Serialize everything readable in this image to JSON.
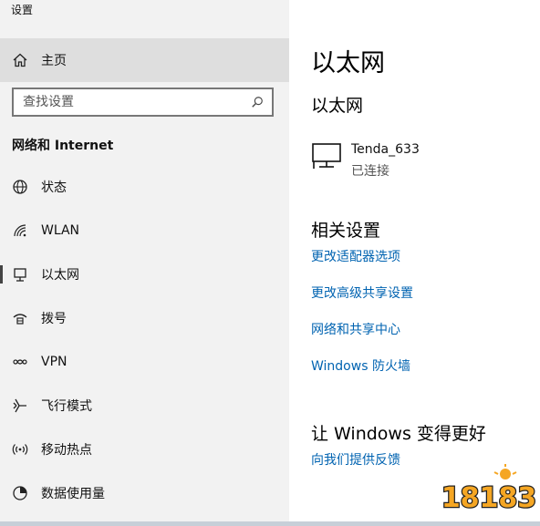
{
  "window": {
    "title": "设置"
  },
  "sidebar": {
    "home_label": "主页",
    "search_placeholder": "查找设置",
    "section_title": "网络和 Internet",
    "items": [
      {
        "label": "状态",
        "icon": "globe-icon"
      },
      {
        "label": "WLAN",
        "icon": "wifi-icon"
      },
      {
        "label": "以太网",
        "icon": "ethernet-icon",
        "selected": true
      },
      {
        "label": "拨号",
        "icon": "dialup-icon"
      },
      {
        "label": "VPN",
        "icon": "vpn-icon"
      },
      {
        "label": "飞行模式",
        "icon": "airplane-icon"
      },
      {
        "label": "移动热点",
        "icon": "hotspot-icon"
      },
      {
        "label": "数据使用量",
        "icon": "data-usage-icon"
      }
    ]
  },
  "main": {
    "page_title": "以太网",
    "section_title": "以太网",
    "network": {
      "name": "Tenda_633",
      "status": "已连接"
    },
    "related_title": "相关设置",
    "related_links": [
      "更改适配器选项",
      "更改高级共享设置",
      "网络和共享中心",
      "Windows 防火墙"
    ],
    "improve_title": "让 Windows 变得更好",
    "feedback_link": "向我们提供反馈"
  },
  "watermark": {
    "text": "18183",
    "colors": [
      "#f5a623",
      "#222222",
      "#ffffff"
    ]
  },
  "colors": {
    "link": "#0063b1",
    "sidebar_bg": "#f2f2f2",
    "selected_bg": "#dedede"
  }
}
